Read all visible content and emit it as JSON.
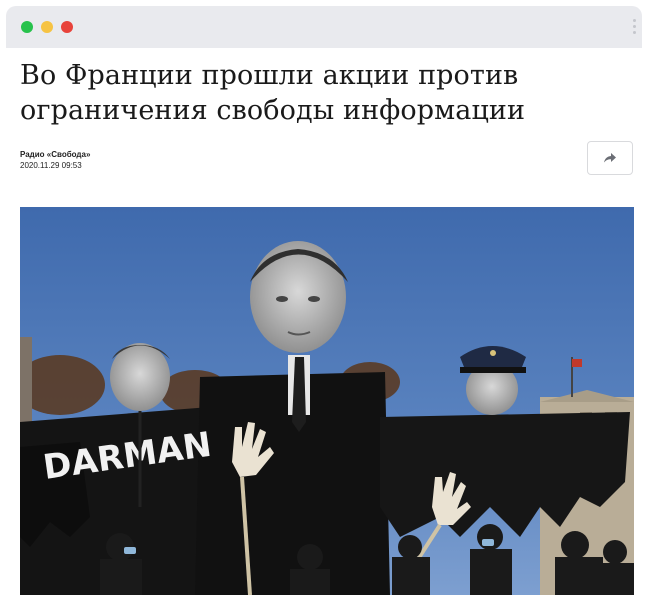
{
  "window": {
    "controls": [
      "green",
      "yellow",
      "red"
    ],
    "menu_icon": "kebab-menu-icon"
  },
  "article": {
    "title": "Во Франции прошли акции против ограничения свободы информации",
    "source": "Радио «Свобода»",
    "datetime": "2020.11.29 09:53",
    "share_icon": "share-arrow-icon"
  },
  "photo": {
    "banner_text": "DARMAN"
  },
  "colors": {
    "titlebar": "#e9eaee",
    "green": "#27c24c",
    "yellow": "#f6c343",
    "red": "#e8433b",
    "sky": "#5079b8"
  }
}
